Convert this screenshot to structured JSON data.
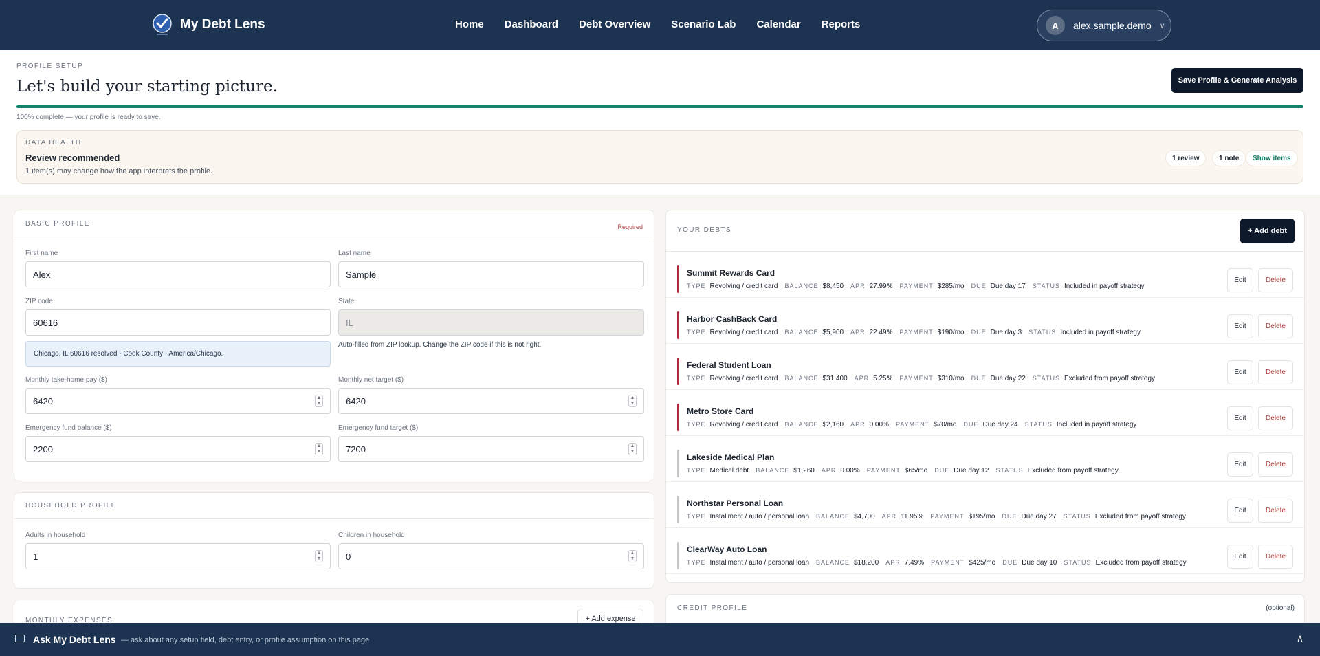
{
  "nav": {
    "brand": "My Debt Lens",
    "links": [
      "Home",
      "Dashboard",
      "Debt Overview",
      "Scenario Lab",
      "Calendar",
      "Reports"
    ],
    "user": {
      "initial": "A",
      "name": "alex.sample.demo"
    }
  },
  "profile_setup": {
    "eyebrow": "PROFILE SETUP",
    "title": "Let's build your starting picture.",
    "save_label": "Save Profile & Generate Analysis",
    "progress_fraction": 1.0,
    "progress_text": "100% complete — your profile is ready to save."
  },
  "data_health": {
    "eyebrow": "DATA HEALTH",
    "title": "Review recommended",
    "subtitle": "1 item(s) may change how the app interprets the profile.",
    "chips": [
      "1 review",
      "1 note",
      "Show items"
    ]
  },
  "basic_profile": {
    "eyebrow": "BASIC PROFILE",
    "required_label": "Required",
    "first_name_label": "First name",
    "first_name": "Alex",
    "last_name_label": "Last name",
    "last_name": "Sample",
    "zip_label": "ZIP code",
    "zip": "60616",
    "state_label": "State",
    "state": "IL",
    "zip_info": "Chicago, IL 60616 resolved · Cook County · America/Chicago.",
    "state_note": "Auto-filled from ZIP lookup. Change the ZIP code if this is not right.",
    "take_home_label": "Monthly take-home pay ($)",
    "take_home": "6420",
    "net_target_label": "Monthly net target ($)",
    "net_target": "6420",
    "ef_balance_label": "Emergency fund balance ($)",
    "ef_balance": "2200",
    "ef_target_label": "Emergency fund target ($)",
    "ef_target": "7200"
  },
  "household_profile": {
    "eyebrow": "HOUSEHOLD PROFILE",
    "adults_label": "Adults in household",
    "adults": "1",
    "children_label": "Children in household",
    "children": "0"
  },
  "monthly_expenses": {
    "eyebrow": "MONTHLY EXPENSES",
    "add_label": "+ Add expense"
  },
  "debts": {
    "eyebrow": "YOUR DEBTS",
    "add_label": "+ Add debt",
    "meta_keys": {
      "type": "TYPE",
      "balance": "BALANCE",
      "apr": "APR",
      "payment": "PAYMENT",
      "due": "DUE",
      "status": "STATUS"
    },
    "edit_label": "Edit",
    "delete_label": "Delete",
    "items": [
      {
        "name": "Summit Rewards Card",
        "type": "Revolving / credit card",
        "balance": "$8,450",
        "apr": "27.99%",
        "payment": "$285/mo",
        "due": "Due day 17",
        "status": "Included in payoff strategy",
        "accent": "#b0293c"
      },
      {
        "name": "Harbor CashBack Card",
        "type": "Revolving / credit card",
        "balance": "$5,900",
        "apr": "22.49%",
        "payment": "$190/mo",
        "due": "Due day 3",
        "status": "Included in payoff strategy",
        "accent": "#b0293c"
      },
      {
        "name": "Federal Student Loan",
        "type": "Revolving / credit card",
        "balance": "$31,400",
        "apr": "5.25%",
        "payment": "$310/mo",
        "due": "Due day 22",
        "status": "Excluded from payoff strategy",
        "accent": "#b0293c"
      },
      {
        "name": "Metro Store Card",
        "type": "Revolving / credit card",
        "balance": "$2,160",
        "apr": "0.00%",
        "payment": "$70/mo",
        "due": "Due day 24",
        "status": "Included in payoff strategy",
        "accent": "#b0293c"
      },
      {
        "name": "Lakeside Medical Plan",
        "type": "Medical debt",
        "balance": "$1,260",
        "apr": "0.00%",
        "payment": "$65/mo",
        "due": "Due day 12",
        "status": "Excluded from payoff strategy",
        "accent": "#c4c6c8"
      },
      {
        "name": "Northstar Personal Loan",
        "type": "Installment / auto / personal loan",
        "balance": "$4,700",
        "apr": "11.95%",
        "payment": "$195/mo",
        "due": "Due day 27",
        "status": "Excluded from payoff strategy",
        "accent": "#c4c6c8"
      },
      {
        "name": "ClearWay Auto Loan",
        "type": "Installment / auto / personal loan",
        "balance": "$18,200",
        "apr": "7.49%",
        "payment": "$425/mo",
        "due": "Due day 10",
        "status": "Excluded from payoff strategy",
        "accent": "#c4c6c8"
      }
    ]
  },
  "credit_profile": {
    "eyebrow": "CREDIT PROFILE",
    "optional_label": "(optional)"
  },
  "chat": {
    "title": "Ask My Debt Lens",
    "hint": "— ask about any setup field, debt entry, or profile assumption on this page"
  }
}
